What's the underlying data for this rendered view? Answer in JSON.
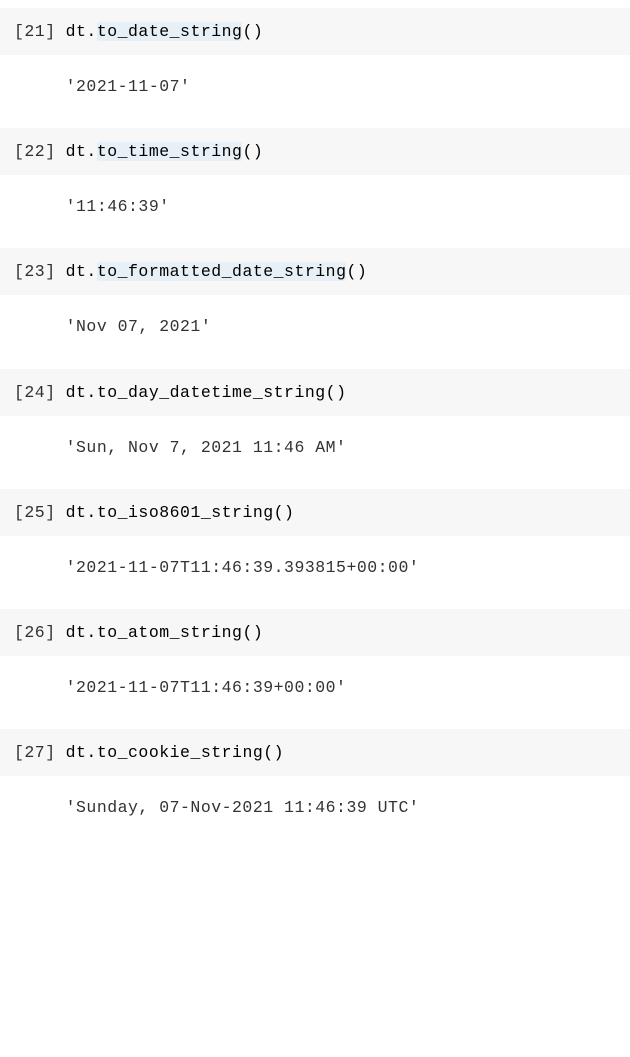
{
  "cells": [
    {
      "prompt": "[21]",
      "code_prefix": "dt.",
      "code_method": "to_date_string",
      "code_suffix": "()",
      "highlight_method": true,
      "output": "'2021-11-07'"
    },
    {
      "prompt": "[22]",
      "code_prefix": "dt.",
      "code_method": "to_time_string",
      "code_suffix": "()",
      "highlight_method": true,
      "output": "'11:46:39'"
    },
    {
      "prompt": "[23]",
      "code_prefix": "dt.",
      "code_method": "to_formatted_date_string",
      "code_suffix": "()",
      "highlight_method": true,
      "output": "'Nov 07, 2021'"
    },
    {
      "prompt": "[24]",
      "code_prefix": "dt.",
      "code_method": "to_day_datetime_string",
      "code_suffix": "()",
      "highlight_method": false,
      "output": "'Sun, Nov 7, 2021 11:46 AM'"
    },
    {
      "prompt": "[25]",
      "code_prefix": "dt.",
      "code_method": "to_iso8601_string",
      "code_suffix": "()",
      "highlight_method": false,
      "output": "'2021-11-07T11:46:39.393815+00:00'"
    },
    {
      "prompt": "[26]",
      "code_prefix": "dt.",
      "code_method": "to_atom_string",
      "code_suffix": "()",
      "highlight_method": false,
      "output": "'2021-11-07T11:46:39+00:00'"
    },
    {
      "prompt": "[27]",
      "code_prefix": "dt.",
      "code_method": "to_cookie_string",
      "code_suffix": "()",
      "highlight_method": false,
      "output": "'Sunday, 07-Nov-2021 11:46:39 UTC'"
    }
  ]
}
